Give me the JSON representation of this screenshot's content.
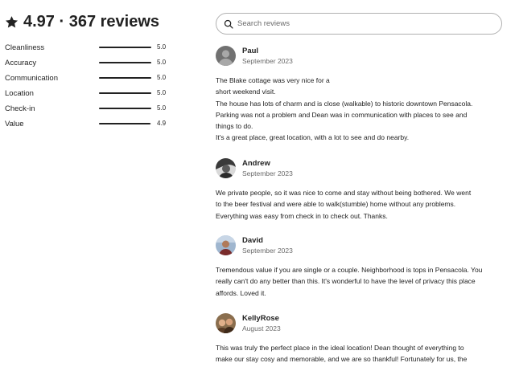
{
  "summary": {
    "title": "4.97 · 367 reviews",
    "categories": [
      {
        "label": "Cleanliness",
        "score": "5.0",
        "value": 5.0
      },
      {
        "label": "Accuracy",
        "score": "5.0",
        "value": 5.0
      },
      {
        "label": "Communication",
        "score": "5.0",
        "value": 5.0
      },
      {
        "label": "Location",
        "score": "5.0",
        "value": 5.0
      },
      {
        "label": "Check-in",
        "score": "5.0",
        "value": 5.0
      },
      {
        "label": "Value",
        "score": "4.9",
        "value": 4.9
      }
    ],
    "max_score": 5.0
  },
  "search": {
    "placeholder": "Search reviews"
  },
  "reviews": [
    {
      "name": "Paul",
      "date": "September 2023",
      "avatar": "default-person-avatar",
      "lines": [
        "The Blake cottage was very nice for a",
        "short weekend visit.",
        "The house has lots of charm and is close (walkable) to historic downtown Pensacola.",
        "Parking was not a problem and Dean was in communication with places to see and",
        "things to do.",
        "It's a great place, great location, with a lot to see and do nearby."
      ]
    },
    {
      "name": "Andrew",
      "date": "September 2023",
      "avatar": "photo-avatar",
      "lines": [
        "We private people, so it was nice to come and stay without being bothered. We went",
        "to the beer festival and were able to walk(stumble) home without any problems.",
        "Everything was easy from check in to check out. Thanks."
      ]
    },
    {
      "name": "David",
      "date": "September 2023",
      "avatar": "photo-avatar",
      "lines": [
        "Tremendous value if you are single or a couple. Neighborhood is tops in Pensacola. You",
        "really can't do any better than this. It's wonderful to have the level of privacy this place",
        "affords. Loved it."
      ]
    },
    {
      "name": "KellyRose",
      "date": "August 2023",
      "avatar": "photo-avatar",
      "lines": [
        "This was truly the perfect place in the ideal location! Dean thought of everything to",
        "make our stay cosy and memorable, and we are so thankful! Fortunately for us, the"
      ]
    }
  ],
  "colors": {
    "text": "#222222",
    "muted": "#6a6a6a",
    "border": "#b0b0b0",
    "bar_track": "#dddddd"
  }
}
